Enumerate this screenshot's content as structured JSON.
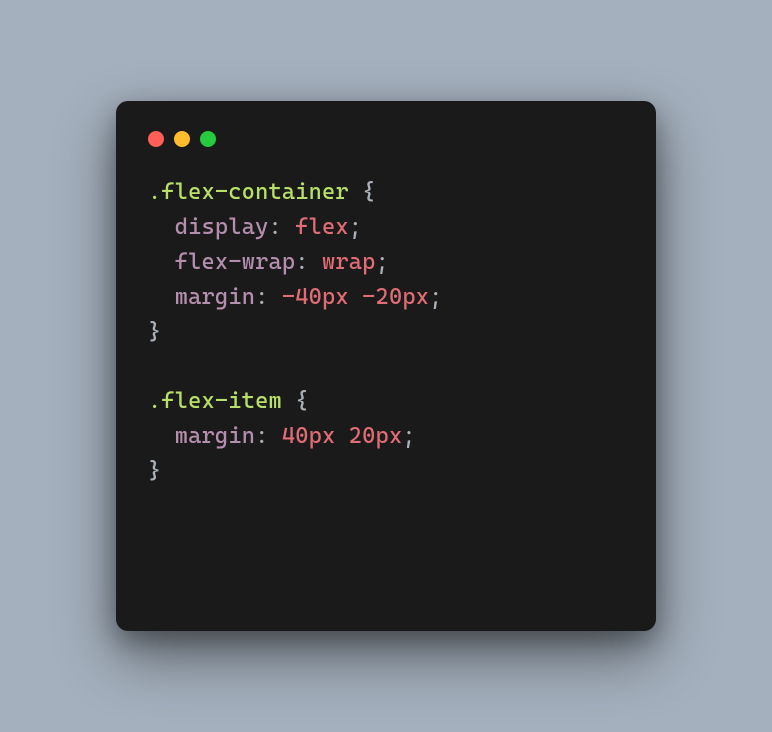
{
  "window": {
    "buttons": [
      "close",
      "minimize",
      "zoom"
    ]
  },
  "code": {
    "rules": [
      {
        "selector": ".flex-container",
        "declarations": [
          {
            "property": "display",
            "value": "flex"
          },
          {
            "property": "flex-wrap",
            "value": "wrap"
          },
          {
            "property": "margin",
            "value": "-40px -20px"
          }
        ]
      },
      {
        "selector": ".flex-item",
        "declarations": [
          {
            "property": "margin",
            "value": "40px 20px"
          }
        ]
      }
    ],
    "openBrace": "{",
    "closeBrace": "}",
    "colon": ":",
    "semicolon": ";",
    "space": " ",
    "indent": "  "
  }
}
